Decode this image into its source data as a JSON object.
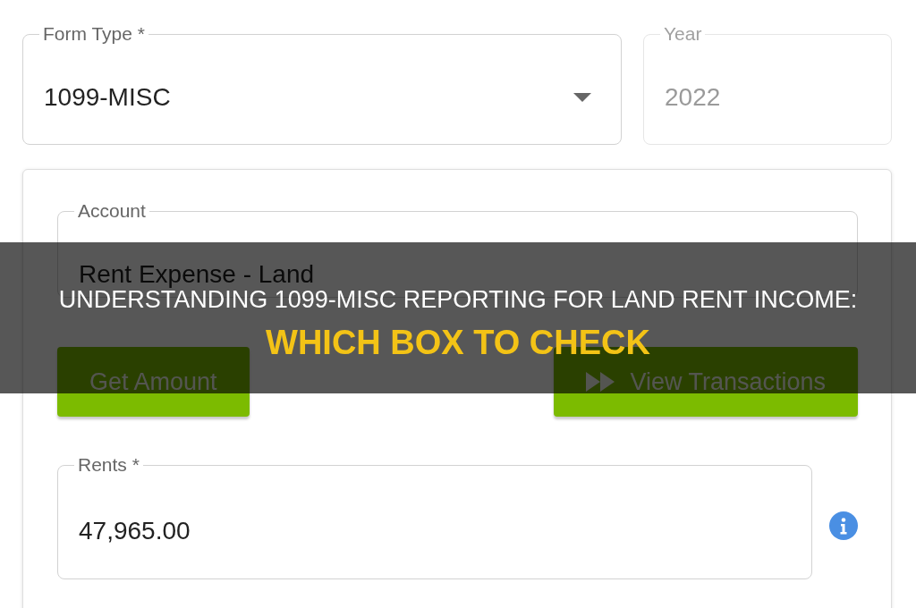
{
  "header_fields": [
    {
      "kind": "dropdown",
      "label": "Form Type *",
      "value": "1099-MISC",
      "disabled": false
    },
    {
      "kind": "text",
      "label": "Year",
      "value": "2022",
      "disabled": true
    }
  ],
  "details_card": {
    "account": {
      "label": "Account",
      "value": "Rent Expense - Land"
    },
    "buttons": [
      {
        "kind": "text",
        "label": "Get Amount"
      },
      {
        "kind": "icon_text",
        "label": "View Transactions"
      }
    ],
    "rents": {
      "label": "Rents *",
      "value": "47,965.00"
    }
  },
  "banner": {
    "title": "UNDERSTANDING 1099-MISC REPORTING FOR LAND RENT INCOME:",
    "subtitle": "WHICH BOX TO CHECK"
  }
}
